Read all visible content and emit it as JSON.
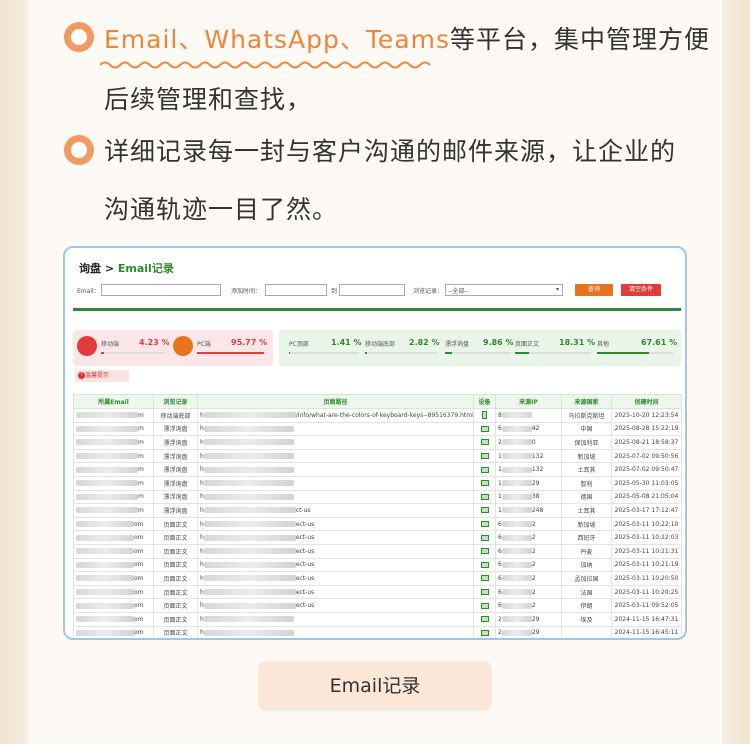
{
  "bullets": {
    "first_highlight": "Email、WhatsApp、Teams",
    "first_rest": "等平台，集中管理方便",
    "first_line2": "后续管理和查找，",
    "second_line1": "详细记录每一封与客户沟通的邮件来源，让企业的",
    "second_line2": "沟通轨迹一目了然。"
  },
  "screenshot": {
    "crumb_prefix": "询盘 > ",
    "crumb_current": "Email记录",
    "filter": {
      "email_label": "Email：",
      "time_label": "添加时间：",
      "to_label": "到",
      "browse_label": "浏览记录：",
      "browse_value": "--全部--",
      "search_btn": "查询",
      "clear_btn": "清空条件"
    },
    "stats": [
      {
        "label": "移动端",
        "value": "4.23 %",
        "fill": 0.04
      },
      {
        "label": "PC端",
        "value": "95.77 %",
        "fill": 0.96
      },
      {
        "label": "PC顶部",
        "value": "1.41 %",
        "fill": 0.02
      },
      {
        "label": "移动端底部",
        "value": "2.82 %",
        "fill": 0.03
      },
      {
        "label": "漂浮询盘",
        "value": "9.86 %",
        "fill": 0.1
      },
      {
        "label": "页面正文",
        "value": "18.31 %",
        "fill": 0.18
      },
      {
        "label": "其他",
        "value": "67.61 %",
        "fill": 0.68
      }
    ],
    "tip": "温馨提示",
    "headers": [
      "所属Email",
      "浏览记录",
      "页面路径",
      "设备",
      "来源IP",
      "来源国家",
      "创建时间"
    ],
    "rows": [
      {
        "email": "m",
        "browse": "移动端底部",
        "path": "/info/what-are-the-colors-of-keyboard-keys--89516379.html",
        "dev": "mobile",
        "ip_a": "8",
        "ip_b": "",
        "country": "马拉斯克斯坦",
        "time": "2025-10-20 12:23:54"
      },
      {
        "email": "m",
        "browse": "漂浮询盘",
        "path": "",
        "dev": "pc",
        "ip_a": "6",
        "ip_b": "42",
        "country": "中国",
        "time": "2025-08-28 15:22:19"
      },
      {
        "email": "m",
        "browse": "漂浮询盘",
        "path": "",
        "dev": "pc",
        "ip_a": "2",
        "ip_b": "0",
        "country": "保加利亚",
        "time": "2025-08-21 18:58:37"
      },
      {
        "email": "m",
        "browse": "漂浮询盘",
        "path": "",
        "dev": "pc",
        "ip_a": "1",
        "ip_b": "132",
        "country": "新加坡",
        "time": "2025-07-02 09:50:56"
      },
      {
        "email": "m",
        "browse": "漂浮询盘",
        "path": "",
        "dev": "pc",
        "ip_a": "1",
        "ip_b": "132",
        "country": "土耳其",
        "time": "2025-07-02 09:50:47"
      },
      {
        "email": "m",
        "browse": "漂浮询盘",
        "path": "",
        "dev": "pc",
        "ip_a": "1",
        "ip_b": "29",
        "country": "智利",
        "time": "2025-05-30 11:03:05"
      },
      {
        "email": "m",
        "browse": "漂浮询盘",
        "path": "",
        "dev": "pc",
        "ip_a": "1",
        "ip_b": "38",
        "country": "德国",
        "time": "2025-05-08 21:05:04"
      },
      {
        "email": "m",
        "browse": "漂浮询盘",
        "path": "ct-us",
        "dev": "pc",
        "ip_a": "1",
        "ip_b": "248",
        "country": "土耳其",
        "time": "2025-03-17 17:12:47"
      },
      {
        "email": "om",
        "browse": "页面正文",
        "path": "ect-us",
        "dev": "pc",
        "ip_a": "6",
        "ip_b": "2",
        "country": "新加坡",
        "time": "2025-03-11 10:22:10"
      },
      {
        "email": "om",
        "browse": "页面正文",
        "path": "ect-us",
        "dev": "pc",
        "ip_a": "6",
        "ip_b": "2",
        "country": "西班牙",
        "time": "2025-03-11 10:22:03"
      },
      {
        "email": "om",
        "browse": "页面正文",
        "path": "ect-us",
        "dev": "pc",
        "ip_a": "6",
        "ip_b": "2",
        "country": "丹麦",
        "time": "2025-03-11 10:21:31"
      },
      {
        "email": "om",
        "browse": "页面正文",
        "path": "ect-us",
        "dev": "pc",
        "ip_a": "6",
        "ip_b": "2",
        "country": "加纳",
        "time": "2025-03-11 10:21:19"
      },
      {
        "email": "om",
        "browse": "页面正文",
        "path": "ect-us",
        "dev": "pc",
        "ip_a": "6",
        "ip_b": "2",
        "country": "孟加拉国",
        "time": "2025-03-11 10:20:50"
      },
      {
        "email": "om",
        "browse": "页面正文",
        "path": "ect-us",
        "dev": "pc",
        "ip_a": "6",
        "ip_b": "2",
        "country": "法国",
        "time": "2025-03-11 10:20:25"
      },
      {
        "email": "om",
        "browse": "页面正文",
        "path": "ect-us",
        "dev": "pc",
        "ip_a": "6",
        "ip_b": "2",
        "country": "伊朗",
        "time": "2025-03-11 09:52:05"
      },
      {
        "email": "om",
        "browse": "页面正文",
        "path": "",
        "dev": "pc",
        "ip_a": "2",
        "ip_b": "29",
        "country": "埃及",
        "time": "2024-11-15 16:47:31"
      },
      {
        "email": "om",
        "browse": "页面正文",
        "path": "",
        "dev": "pc",
        "ip_a": "2",
        "ip_b": "29",
        "country": "",
        "time": "2024-11-15 16:45:11"
      }
    ]
  },
  "caption": "Email记录",
  "colors": {
    "accent": "#f0843a",
    "green": "#2f8a2f",
    "red": "#e03c3c",
    "orange": "#e8741e"
  }
}
